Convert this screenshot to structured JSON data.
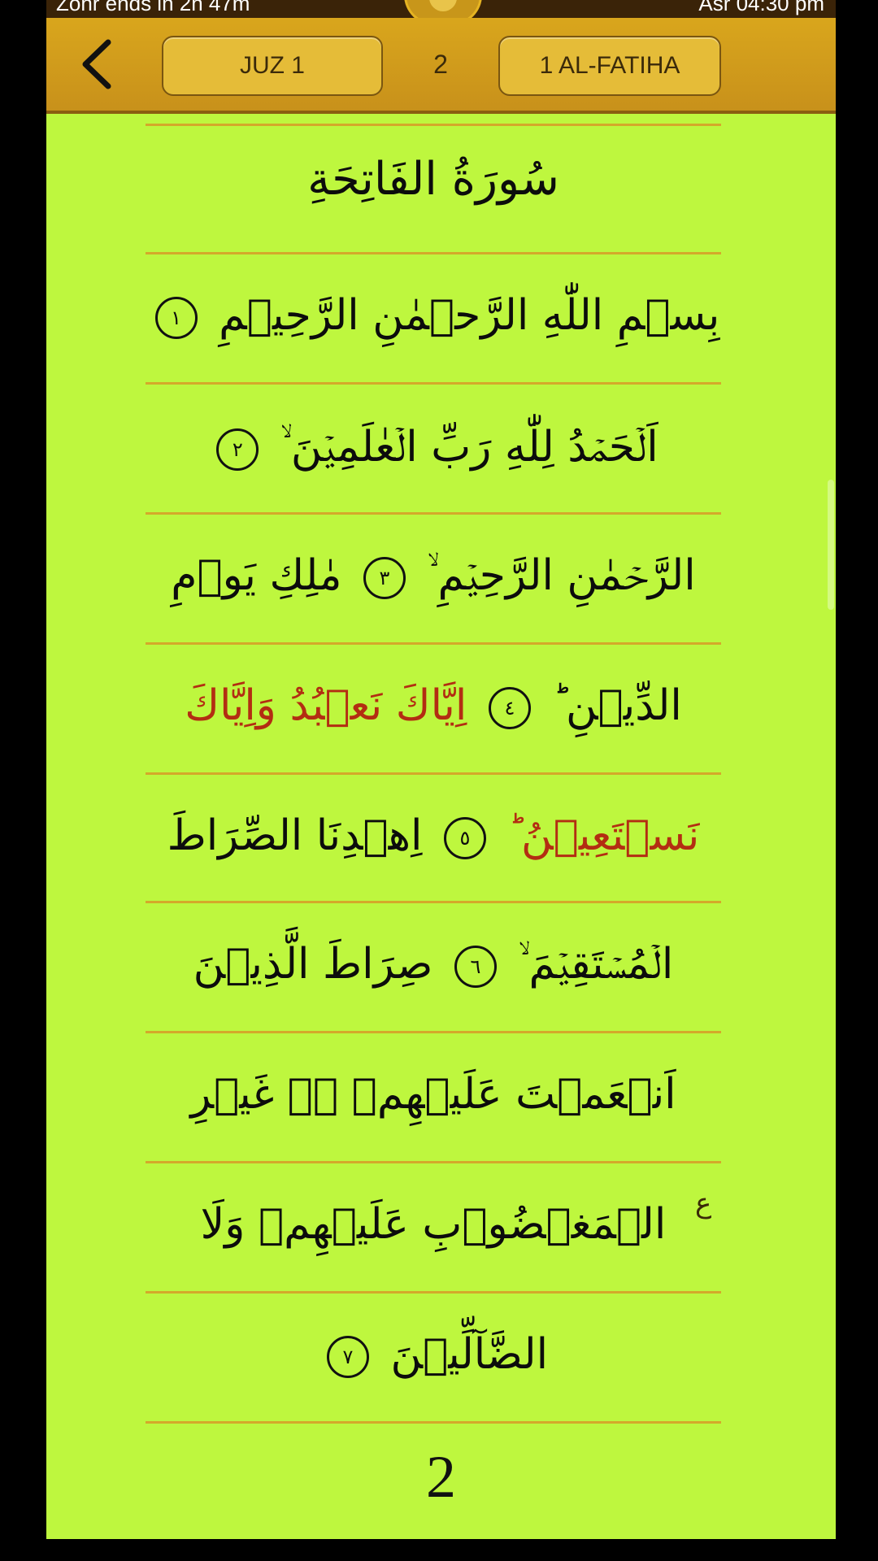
{
  "status": {
    "left_text": "Zohr ends in 2h 47m",
    "right_text": "Asr 04:30 pm"
  },
  "toolbar": {
    "juz_label": "JUZ 1",
    "page_number": "2",
    "surah_label": "1 AL-FATIHA",
    "back_icon": "chevron-left-icon"
  },
  "page": {
    "surah_title": "سُورَةُ الفَاتِحَةِ",
    "lines": [
      {
        "text": "بِسۡمِ اللّٰهِ الرَّحۡمٰنِ الرَّحِيۡمِ",
        "ayah": "١"
      },
      {
        "text": "اَلۡحَمۡدُ لِلّٰهِ رَبِّ الۡعٰلَمِيۡنَ ۙ",
        "ayah": "٢"
      },
      {
        "text_a": "الرَّحۡمٰنِ الرَّحِيۡمِ ۙ",
        "ayah": "٣",
        "text_b": "مٰلِكِ يَوۡمِ"
      },
      {
        "text_a": "الدِّيۡنِ ؕ",
        "ayah": "٤",
        "text_b": "اِيَّاكَ نَعۡبُدُ وَاِيَّاكَ"
      },
      {
        "text_a": "نَسۡتَعِيۡنُ ؕ",
        "ayah": "٥",
        "text_b": "اِهۡدِنَا الصِّرَاطَ"
      },
      {
        "text_a": "الۡمُسۡتَقِيۡمَ ۙ",
        "ayah": "٦",
        "text_b": "صِرَاطَ الَّذِيۡنَ"
      },
      {
        "text": "اَنۡعَمۡتَ عَلَيۡهِمۡ ۙ۬ غَيۡرِ"
      },
      {
        "text": "الۡمَغۡضُوۡبِ عَلَيۡهِمۡ وَلَا"
      },
      {
        "text": "الضَّآلِّيۡنَ",
        "ayah": "٧"
      }
    ],
    "side_mark": "ع",
    "page_footer": "2"
  }
}
